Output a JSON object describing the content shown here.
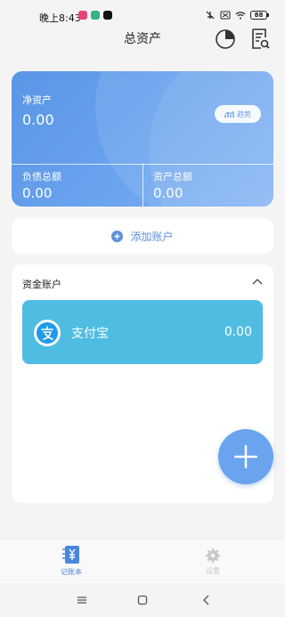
{
  "status_bar": {
    "time": "晚上8:43",
    "battery": "88"
  },
  "header": {
    "title": "总资产",
    "pie_icon": "pie-chart-icon",
    "report_icon": "report-search-icon"
  },
  "summary": {
    "net_assets_label": "净资产",
    "net_assets_value": "0.00",
    "trend_label": "趋势",
    "liabilities_label": "负债总额",
    "liabilities_value": "0.00",
    "assets_label": "资产总额",
    "assets_value": "0.00"
  },
  "add_account": {
    "label": "添加账户"
  },
  "funds": {
    "title": "资金账户",
    "accounts": [
      {
        "name": "支付宝",
        "balance": "0.00",
        "icon": "alipay-icon"
      }
    ]
  },
  "tabs": [
    {
      "label": "记账本",
      "icon": "ledger-icon",
      "active": true
    },
    {
      "label": "设置",
      "icon": "gear-icon",
      "active": false
    }
  ],
  "colors": {
    "accent": "#6aa3ee",
    "account_card": "#4fbde2",
    "tab_active": "#4a86de",
    "tab_inactive": "#c8c8c8"
  }
}
